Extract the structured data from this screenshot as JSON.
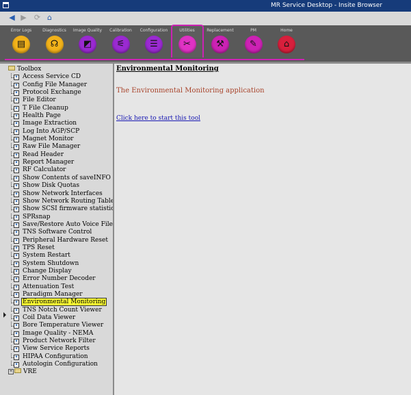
{
  "window": {
    "title": "MR Service Desktop - Insite  Browser"
  },
  "nav": {
    "back": "◀",
    "forward": "▶",
    "refresh": "⟳",
    "home": "⌂"
  },
  "toolbar": {
    "tabs": [
      {
        "label": "Error Logs",
        "glyph": "▤",
        "color": "#f2b21a",
        "selected": false
      },
      {
        "label": "Diagnostics",
        "glyph": "☊",
        "color": "#f2b21a",
        "selected": false
      },
      {
        "label": "Image Quality",
        "glyph": "◩",
        "color": "#9a2ad1",
        "selected": false
      },
      {
        "label": "Calibration",
        "glyph": "⚟",
        "color": "#9a2ad1",
        "selected": false
      },
      {
        "label": "Configuration",
        "glyph": "☰",
        "color": "#9a2ad1",
        "selected": false
      },
      {
        "label": "Utilities",
        "glyph": "✂",
        "color": "#e032c4",
        "selected": true
      },
      {
        "label": "Replacement",
        "glyph": "⚒",
        "color": "#cc22b4",
        "selected": false
      },
      {
        "label": "PM",
        "glyph": "✎",
        "color": "#cc22b4",
        "selected": false
      },
      {
        "label": "Home",
        "glyph": "⌂",
        "color": "#d81f3c",
        "selected": false
      }
    ]
  },
  "tree": {
    "root": "Toolbox",
    "items": [
      "Access Service CD",
      "Config File Manager",
      "Protocol Exchange",
      "File Editor",
      "T File Cleanup",
      "Health Page",
      "Image Extraction",
      "Log Into AGP/SCP",
      "Magnet Monitor",
      "Raw File Manager",
      "Read Header",
      "Report Manager",
      "RF Calculator",
      "Show Contents of saveINFO M",
      "Show Disk Quotas",
      "Show Network Interfaces",
      "Show Network Routing Tables",
      "Show SCSI firmware statistic:",
      "SPRsnap",
      "Save/Restore Auto Voice Files",
      "TNS Software Control",
      "Peripheral Hardware Reset",
      "TPS Reset",
      "System Restart",
      "System Shutdown",
      "Change Display",
      "Error Number Decoder",
      "Attenuation Test",
      "Paradigm Manager",
      "Environmental Monitoring",
      "TNS Notch Count Viewer",
      "Coil Data Viewer",
      "Bore Temperature Viewer",
      "Image Quality - NEMA",
      "Product Network Filter",
      "View Service Reports",
      "HIPAA Configuration",
      "Autologin Configuration"
    ],
    "selected_index": 29,
    "vre": "VRE"
  },
  "content": {
    "heading": "Environmental Monitoring",
    "description": "The Environmental Monitoring application",
    "start_link": "Click here to start this tool"
  }
}
